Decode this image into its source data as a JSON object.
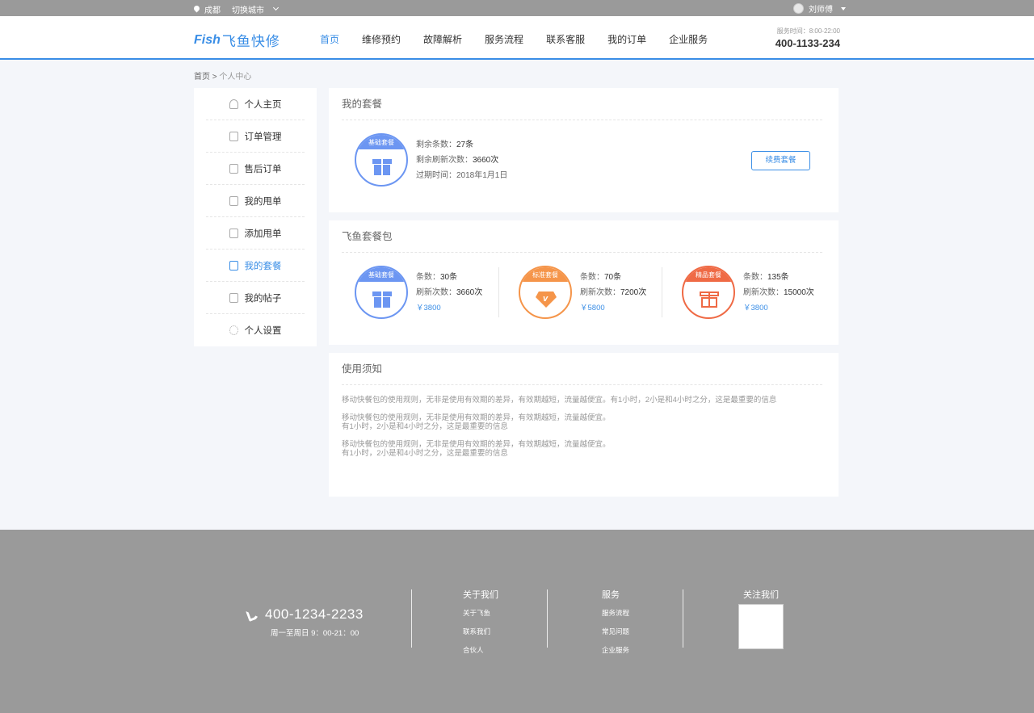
{
  "topbar": {
    "city": "成都",
    "switch_city": "切换城市",
    "username": "刘师傅"
  },
  "header": {
    "logo_en": "Fish",
    "logo_cn": "飞鱼快修",
    "nav": [
      "首页",
      "维修预约",
      "故障解析",
      "服务流程",
      "联系客服",
      "我的订单",
      "企业服务"
    ],
    "service_time": "服务时间：8:00-22:00",
    "service_phone": "400-1133-234"
  },
  "breadcrumb": {
    "home": "首页",
    "sep": ">",
    "current": "个人中心"
  },
  "sidebar": {
    "items": [
      {
        "label": "个人主页",
        "icon": "person-icon"
      },
      {
        "label": "订单管理",
        "icon": "clipboard-icon"
      },
      {
        "label": "售后订单",
        "icon": "service-icon"
      },
      {
        "label": "我的甩单",
        "icon": "document-icon"
      },
      {
        "label": "添加甩单",
        "icon": "edit-document-icon"
      },
      {
        "label": "我的套餐",
        "icon": "gift-icon",
        "active": true
      },
      {
        "label": "我的帖子",
        "icon": "post-icon"
      },
      {
        "label": "个人设置",
        "icon": "gear-icon"
      }
    ]
  },
  "my_package": {
    "title": "我的套餐",
    "badge": "基础套餐",
    "remaining_label": "剩余条数：",
    "remaining_value": "27条",
    "refresh_label": "剩余刷新次数：",
    "refresh_value": "3660次",
    "expire_label": "过期时间：",
    "expire_value": "2018年1月1日",
    "renew_button": "续费套餐"
  },
  "packages": {
    "title": "飞鱼套餐包",
    "items": [
      {
        "badge": "基础套餐",
        "count_label": "条数：",
        "count": "30条",
        "refresh_label": "刷新次数：",
        "refresh": "3660次",
        "price": "￥3800",
        "color": "#6c96f2"
      },
      {
        "badge": "标准套餐",
        "count_label": "条数：",
        "count": "70条",
        "refresh_label": "刷新次数：",
        "refresh": "7200次",
        "price": "￥5800",
        "color": "#f5954a"
      },
      {
        "badge": "精品套餐",
        "count_label": "条数：",
        "count": "135条",
        "refresh_label": "刷新次数：",
        "refresh": "15000次",
        "price": "￥3800",
        "color": "#ef6a45"
      }
    ]
  },
  "notice": {
    "title": "使用须知",
    "paragraphs": [
      [
        "移动快餐包的使用规则，无非是使用有效期的差异，有效期越短，流量越便宜。有1小时，2小是和4小时之分，这是最重要的信息"
      ],
      [
        "移动快餐包的使用规则，无非是使用有效期的差异，有效期越短，流量越便宜。",
        "有1小时，2小是和4小时之分，这是最重要的信息"
      ],
      [
        "移动快餐包的使用规则，无非是使用有效期的差异，有效期越短，流量越便宜。",
        "有1小时，2小是和4小时之分，这是最重要的信息"
      ]
    ]
  },
  "footer": {
    "phone": "400-1234-2233",
    "hours": "周一至周日 9：00-21：00",
    "about": {
      "title": "关于我们",
      "links": [
        "关于飞鱼",
        "联系我们",
        "合伙人"
      ]
    },
    "service": {
      "title": "服务",
      "links": [
        "服务流程",
        "常见问题",
        "企业服务"
      ]
    },
    "follow": {
      "title": "关注我们"
    }
  }
}
